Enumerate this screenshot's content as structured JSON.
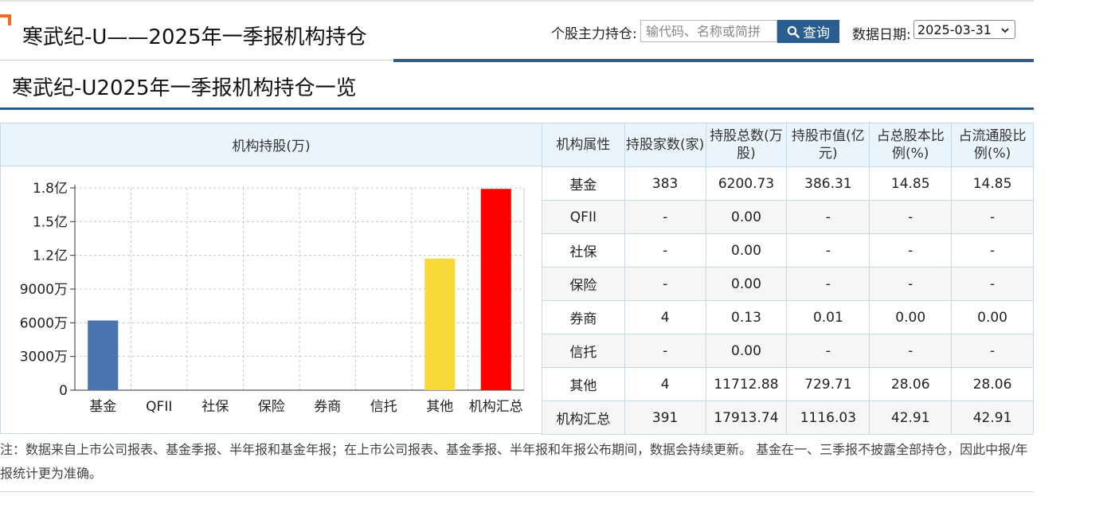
{
  "header": {
    "title": "寒武纪-U——2025年一季报机构持仓",
    "search_label": "个股主力持仓:",
    "search_placeholder": "输代码、名称或简拼",
    "search_button": "查询",
    "date_label": "数据日期:",
    "date_value": "2025-03-31"
  },
  "section": {
    "title": "寒武纪-U2025年一季报机构持仓一览",
    "chart_header": "机构持股(万)"
  },
  "colors": {
    "accent": "#2b5d8f",
    "bar_fund": "#4a74ad",
    "bar_other": "#f8d93a",
    "bar_total": "#ff0000",
    "header_bg": "#eaf4fd"
  },
  "chart_data": {
    "type": "bar",
    "categories": [
      "基金",
      "QFII",
      "社保",
      "保险",
      "券商",
      "信托",
      "其他",
      "机构汇总"
    ],
    "values": [
      6200.73,
      0,
      0,
      0,
      0.13,
      0,
      11712.88,
      17913.74
    ],
    "ylim": [
      0,
      18000
    ],
    "yticks": [
      0,
      3000,
      6000,
      9000,
      12000,
      15000,
      18000
    ],
    "ytick_labels": [
      "0",
      "3000万",
      "6000万",
      "9000万",
      "1.2亿",
      "1.5亿",
      "1.8亿"
    ],
    "grid": true,
    "bar_colors": [
      "#4a74ad",
      "#4a74ad",
      "#4a74ad",
      "#4a74ad",
      "#4a74ad",
      "#4a74ad",
      "#f8d93a",
      "#ff0000"
    ]
  },
  "table": {
    "headers": [
      "机构属性",
      "持股家数(家)",
      "持股总数(万股)",
      "持股市值(亿元)",
      "占总股本比例(%)",
      "占流通股比例(%)"
    ],
    "rows": [
      [
        "基金",
        "383",
        "6200.73",
        "386.31",
        "14.85",
        "14.85"
      ],
      [
        "QFII",
        "-",
        "0.00",
        "-",
        "-",
        "-"
      ],
      [
        "社保",
        "-",
        "0.00",
        "-",
        "-",
        "-"
      ],
      [
        "保险",
        "-",
        "0.00",
        "-",
        "-",
        "-"
      ],
      [
        "券商",
        "4",
        "0.13",
        "0.01",
        "0.00",
        "0.00"
      ],
      [
        "信托",
        "-",
        "0.00",
        "-",
        "-",
        "-"
      ],
      [
        "其他",
        "4",
        "11712.88",
        "729.71",
        "28.06",
        "28.06"
      ],
      [
        "机构汇总",
        "391",
        "17913.74",
        "1116.03",
        "42.91",
        "42.91"
      ]
    ]
  },
  "note": "注：数据来自上市公司报表、基金季报、半年报和基金年报；在上市公司报表、基金季报、半年报和年报公布期间，数据会持续更新。 基金在一、三季报不披露全部持仓，因此中报/年报统计更为准确。"
}
